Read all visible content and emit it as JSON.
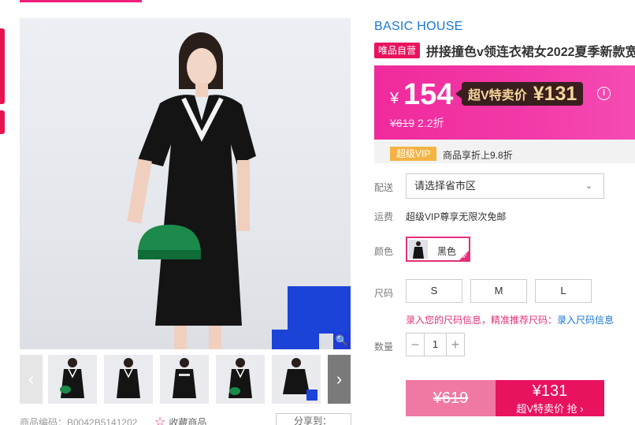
{
  "gallery": {
    "zoom_icon": "magnifier-icon",
    "prev_icon": "chevron-left-icon",
    "next_icon": "chevron-right-icon",
    "prev_glyph": "‹",
    "next_glyph": "›",
    "zoom_glyph": "🔍"
  },
  "meta": {
    "product_code": "商品编码：B0042B5141202",
    "favorite_label": "收藏商品",
    "share_label": "分享到："
  },
  "product": {
    "brand": "BASIC HOUSE",
    "self_badge": "唯品自营",
    "title": "拼接撞色v领连衣裙女2022夏季新款宽"
  },
  "price": {
    "currency": "¥",
    "sale_price": "154",
    "svip_label": "超V特卖价",
    "svip_price": "¥131",
    "original_price": "¥619",
    "discount": "2.2折",
    "info_glyph": "i"
  },
  "vip": {
    "badge": "超级VIP",
    "text": "商品享折上9.8折"
  },
  "delivery": {
    "label": "配送",
    "placeholder": "请选择省市区",
    "chevron_glyph": "⌄"
  },
  "shipping": {
    "label": "运费",
    "text": "超级VIP尊享无限次免邮"
  },
  "color": {
    "label": "颜色",
    "selected": "黑色",
    "check_glyph": "✓"
  },
  "size": {
    "label": "尺码",
    "options": [
      "S",
      "M",
      "L"
    ],
    "hint": "录入您的尺码信息，精准推荐尺码：",
    "hint_link": "录入尺码信息"
  },
  "quantity": {
    "label": "数量",
    "value": "1",
    "minus": "−",
    "plus": "+"
  },
  "buy": {
    "original_price": "¥619",
    "svip_price": "¥131",
    "svip_action": "超V特卖价 抢 ›"
  },
  "colors": {
    "accent": "#e8125f",
    "brand_blue": "#1877d6",
    "price_panel": "#f02a9c",
    "vip_gold": "#f3b444"
  }
}
